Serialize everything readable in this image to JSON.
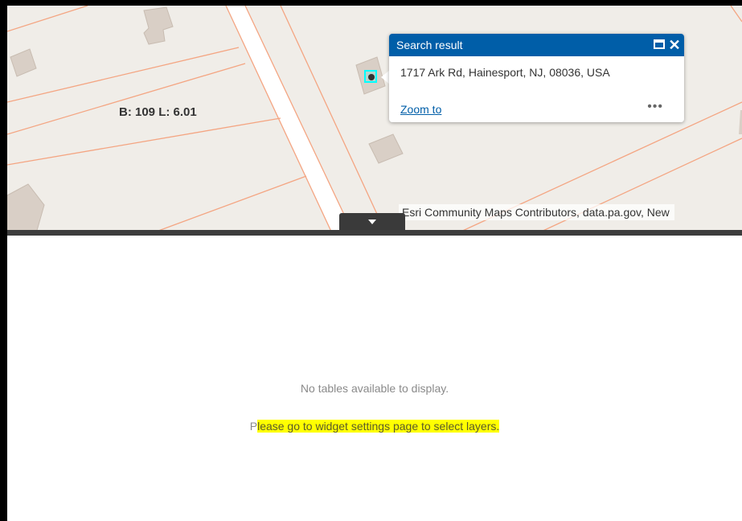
{
  "map": {
    "parcel_label": "B: 109 L: 6.01",
    "attribution": "Esri Community Maps Contributors, data.pa.gov, New",
    "colors": {
      "background": "#f0ede8",
      "parcel_lines": "#f4a582",
      "buildings": "#d9cfc6",
      "road": "#ffffff",
      "marker": "#00ffff"
    }
  },
  "popup": {
    "title": "Search result",
    "address": "1717 Ark Rd, Hainesport, NJ, 08036, USA",
    "zoom_label": "Zoom to",
    "more_label": "•••",
    "maximize_icon": "maximize-icon",
    "close_icon": "close-icon",
    "header_color": "#005ea8"
  },
  "attribute_table": {
    "no_tables": "No tables available to display.",
    "settings_first_char": "P",
    "settings_rest": "lease go to widget settings page to select layers.",
    "highlight_color": "#ffff00"
  }
}
